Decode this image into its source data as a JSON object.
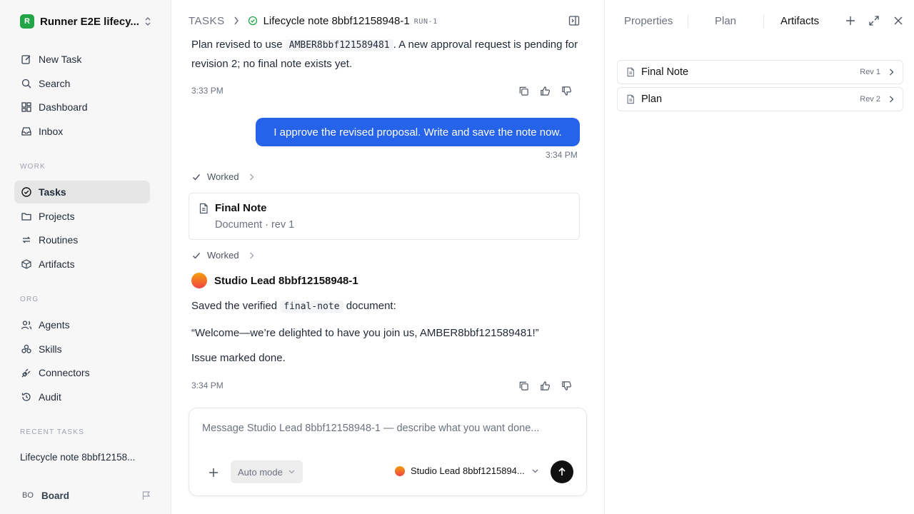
{
  "workspace": {
    "logo_letter": "R",
    "name": "Runner E2E lifecy..."
  },
  "sidebar": {
    "top_items": [
      {
        "label": "New Task",
        "icon": "edit-icon"
      },
      {
        "label": "Search",
        "icon": "search-icon"
      },
      {
        "label": "Dashboard",
        "icon": "dashboard-icon"
      },
      {
        "label": "Inbox",
        "icon": "inbox-icon"
      }
    ],
    "work_label": "WORK",
    "work_items": [
      {
        "label": "Tasks",
        "icon": "check-circle-icon",
        "active": true
      },
      {
        "label": "Projects",
        "icon": "folder-icon"
      },
      {
        "label": "Routines",
        "icon": "repeat-icon"
      },
      {
        "label": "Artifacts",
        "icon": "box-icon"
      }
    ],
    "org_label": "ORG",
    "org_items": [
      {
        "label": "Agents",
        "icon": "users-icon"
      },
      {
        "label": "Skills",
        "icon": "skills-icon"
      },
      {
        "label": "Connectors",
        "icon": "plug-icon"
      },
      {
        "label": "Audit",
        "icon": "history-icon"
      }
    ],
    "recent_label": "RECENT TASKS",
    "recent_item": "Lifecycle note 8bbf12158...",
    "board": {
      "initials": "BO",
      "name": "Board"
    }
  },
  "header": {
    "crumb": "TASKS",
    "title": "Lifecycle note 8bbf12158948-1",
    "run": "RUN-1"
  },
  "messages": {
    "first": {
      "pre": "Plan revised to use ",
      "code": "AMBER8bbf121589481",
      "post": ". A new approval request is pending for revision 2; no final note exists yet.",
      "time": "3:33 PM"
    },
    "user": {
      "text": "I approve the revised proposal. Write and save the note now.",
      "time": "3:34 PM"
    },
    "worked_label": "Worked",
    "doc": {
      "title": "Final Note",
      "meta": "Document · rev 1"
    },
    "agent": {
      "name": "Studio Lead 8bbf12158948-1",
      "line1_pre": "Saved the verified ",
      "line1_code": "final-note",
      "line1_post": " document:",
      "quote": "“Welcome—we’re delighted to have you join us, AMBER8bbf121589481!”",
      "done": "Issue marked done.",
      "time": "3:34 PM"
    }
  },
  "composer": {
    "placeholder": "Message Studio Lead 8bbf12158948-1 — describe what you want done...",
    "mode": "Auto mode",
    "agent": "Studio Lead 8bbf1215894..."
  },
  "right_panel": {
    "tabs": [
      "Properties",
      "Plan",
      "Artifacts"
    ],
    "active_tab": "Artifacts",
    "artifacts": [
      {
        "name": "Final Note",
        "rev": "Rev 1"
      },
      {
        "name": "Plan",
        "rev": "Rev 2"
      }
    ]
  },
  "colors": {
    "accent": "#2563eb",
    "workspace_logo": "#22a447",
    "active_nav": "#e6e6e6"
  }
}
